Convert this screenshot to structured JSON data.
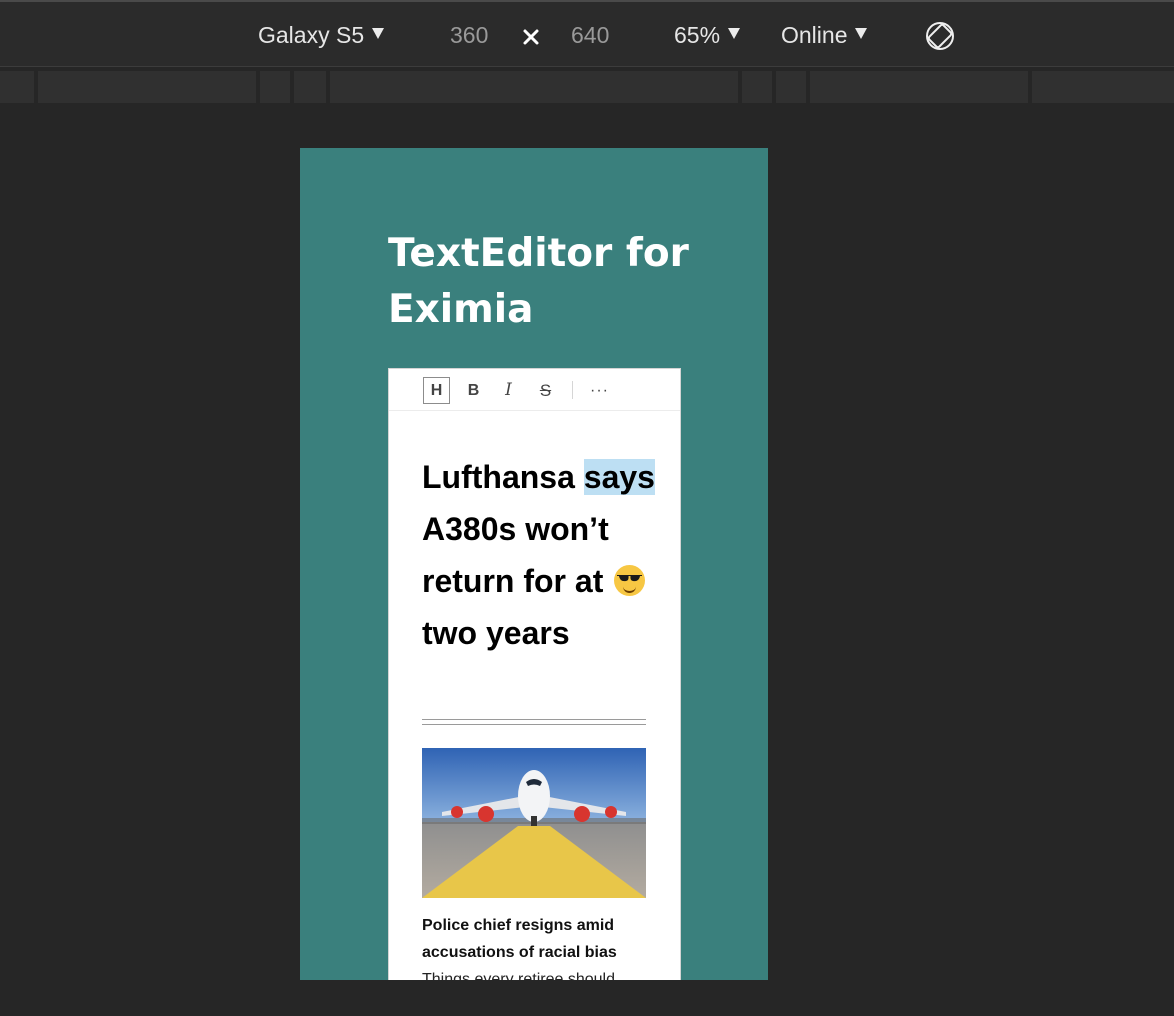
{
  "device_toolbar": {
    "device": "Galaxy S5",
    "width": "360",
    "height": "640",
    "zoom": "65%",
    "throttle": "Online"
  },
  "app": {
    "title": "TextEditor for Eximia"
  },
  "editor_toolbar": {
    "heading": "H",
    "bold": "B",
    "italic": "I",
    "strike": "S",
    "more": "···"
  },
  "document": {
    "headline_first": "Lufthansa",
    "headline_highlight": "says",
    "headline_mid": "A380s won’t return for at",
    "headline_end": "two years",
    "emoji": "smiling-face-with-sunglasses",
    "image_subject": "Airbus A380 parked on apron",
    "caption": "Police chief resigns amid accusations of racial bias",
    "snippet": "Things every retiree should"
  },
  "colors": {
    "frame_background": "#3a807d",
    "highlight": "#bddff3",
    "app_background": "#262626"
  }
}
